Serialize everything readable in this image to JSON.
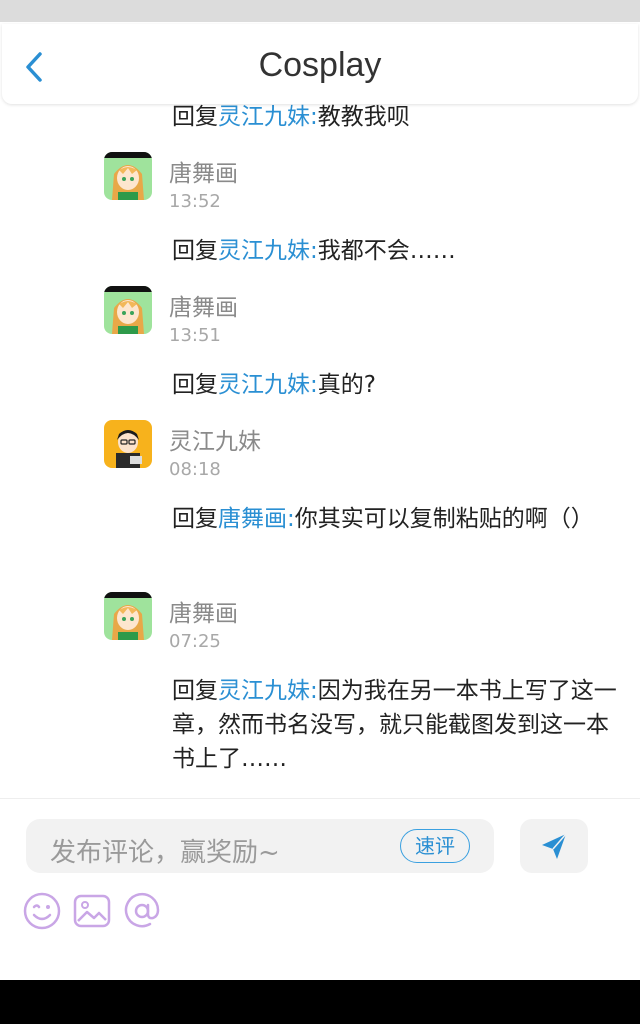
{
  "header": {
    "title": "Cosplay",
    "back_icon": "chevron-left-icon"
  },
  "colors": {
    "mention": "#2a8fd3",
    "accent": "#3aa0e0"
  },
  "feed": {
    "top_reply": {
      "prefix": "回复",
      "mention": "灵江九妹:",
      "text": "教教我呗"
    },
    "items": [
      {
        "name": "唐舞画",
        "time": "13:52",
        "reply": {
          "prefix": "回复",
          "mention": "灵江九妹:",
          "text": "我都不会……"
        }
      },
      {
        "name": "唐舞画",
        "time": "13:51",
        "reply": {
          "prefix": "回复",
          "mention": "灵江九妹:",
          "text": "真的?"
        }
      },
      {
        "name": "灵江九妹",
        "time": "08:18",
        "reply": {
          "prefix": "回复",
          "mention": "唐舞画:",
          "text": "你其实可以复制粘贴的啊（）"
        }
      },
      {
        "name": "唐舞画",
        "time": "07:25",
        "reply": {
          "prefix": "回复",
          "mention": "灵江九妹:",
          "text": "因为我在另一本书上写了这一章，然而书名没写，就只能截图发到这一本书上了……"
        }
      }
    ]
  },
  "composer": {
    "placeholder": "发布评论，赢奖励~",
    "quick_label": "速评",
    "send_icon": "send-icon",
    "tools": [
      "emoji-icon",
      "image-icon",
      "at-icon"
    ]
  }
}
